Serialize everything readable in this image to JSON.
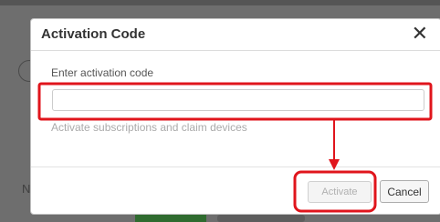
{
  "dialog": {
    "title": "Activation Code",
    "close_glyph": "✕",
    "field_label": "Enter activation code",
    "input_value": "",
    "input_placeholder": "",
    "help_text": "Activate subscriptions and claim devices",
    "activate_label": "Activate",
    "activate_enabled": false,
    "cancel_label": "Cancel"
  },
  "annotation": {
    "color": "#e0151c"
  },
  "icons": {
    "close": "close-icon",
    "arrow": "arrow-down-icon"
  }
}
